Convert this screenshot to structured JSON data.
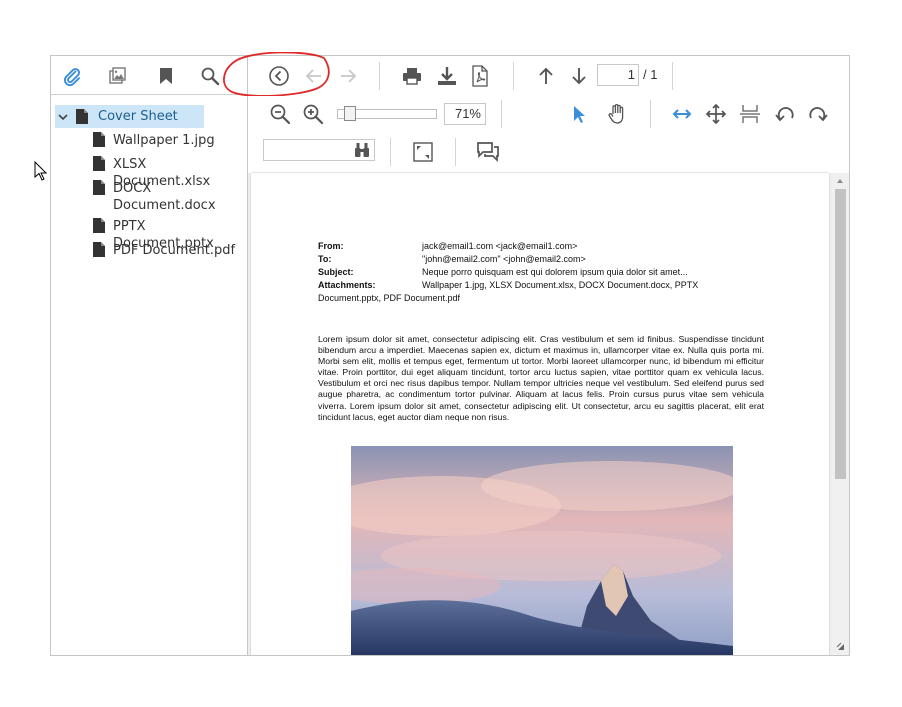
{
  "sidebar": {
    "tabs": [
      {
        "name": "attachments-tab",
        "icon": "paperclip-icon"
      },
      {
        "name": "thumbnails-tab",
        "icon": "images-icon"
      },
      {
        "name": "bookmarks-tab",
        "icon": "bookmark-icon"
      },
      {
        "name": "search-tab",
        "icon": "search-icon"
      }
    ],
    "tree": {
      "root": "Cover Sheet",
      "children": [
        "Wallpaper 1.jpg",
        "XLSX Document.xlsx",
        "DOCX",
        "Document.docx",
        "PPTX Document.pptx",
        "PDF Document.pdf"
      ]
    }
  },
  "toolbar": {
    "page_current": "1",
    "page_total": "/ 1",
    "zoom": "71%",
    "search_value": ""
  },
  "document": {
    "header": [
      {
        "key": "From:",
        "value": "jack@email1.com <jack@email1.com>"
      },
      {
        "key": "To:",
        "value": "\"john@email2.com\" <john@email2.com>"
      },
      {
        "key": "Subject:",
        "value": "Neque porro quisquam est qui dolorem ipsum quia dolor sit amet..."
      },
      {
        "key": "Attachments:",
        "value": "Wallpaper 1.jpg, XLSX Document.xlsx, DOCX Document.docx, PPTX"
      }
    ],
    "attachments_cont": "Document.pptx, PDF Document.pdf",
    "body": "Lorem ipsum dolor sit amet, consectetur adipiscing elit. Cras vestibulum et sem id finibus. Suspendisse tincidunt bibendum arcu a imperdiet. Maecenas sapien ex, dictum et maximus in, ullamcorper vitae ex. Nulla quis porta mi. Morbi sem elit, mollis et tempus eget, fermentum ut tortor. Morbi laoreet ullamcorper nunc, id bibendum mi efficitur vitae. Proin porttitor, dui eget aliquam tincidunt, tortor arcu luctus sapien, vitae porttitor quam ex vehicula lacus. Vestibulum et orci nec risus dapibus tempor. Nullam tempor ultricies neque vel vestibulum. Sed eleifend purus sed augue pharetra, ac condimentum tortor pulvinar. Aliquam at lacus felis. Proin cursus purus vitae sem vehicula viverra. Lorem ipsum dolor sit amet, consectetur adipiscing elit. Ut consectetur, arcu eu sagittis placerat, elit erat tincidunt lacus, eget auctor diam neque non risus."
  },
  "colors": {
    "accent_blue": "#3b8ed8",
    "icon_gray": "#555555",
    "selection": "#cde6f7",
    "annotation_red": "#e02828"
  }
}
